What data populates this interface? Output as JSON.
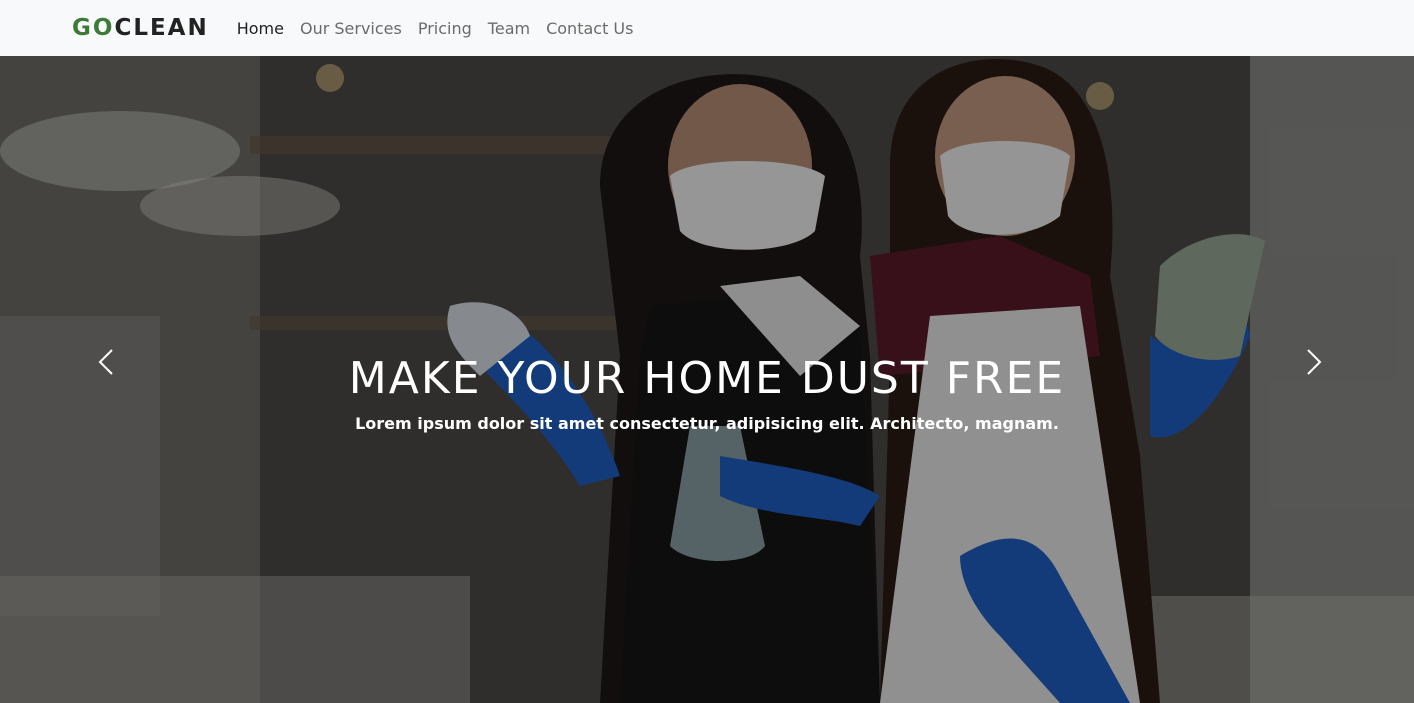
{
  "navbar": {
    "brand_prefix": "GO",
    "brand_suffix": "CLEAN",
    "items": [
      {
        "label": "Home",
        "active": true
      },
      {
        "label": "Our Services",
        "active": false
      },
      {
        "label": "Pricing",
        "active": false
      },
      {
        "label": "Team",
        "active": false
      },
      {
        "label": "Contact Us",
        "active": false
      }
    ]
  },
  "carousel": {
    "headline": "MAKE YOUR HOME DUST FREE",
    "subtext": "Lorem ipsum dolor sit amet consectetur, adipisicing elit. Architecto, magnam.",
    "prev_icon": "chevron-left-icon",
    "next_icon": "chevron-right-icon"
  },
  "colors": {
    "brand_accent": "#3c7a36",
    "navbar_bg": "#f8f9fa",
    "glove_blue": "#1f5fc4"
  }
}
